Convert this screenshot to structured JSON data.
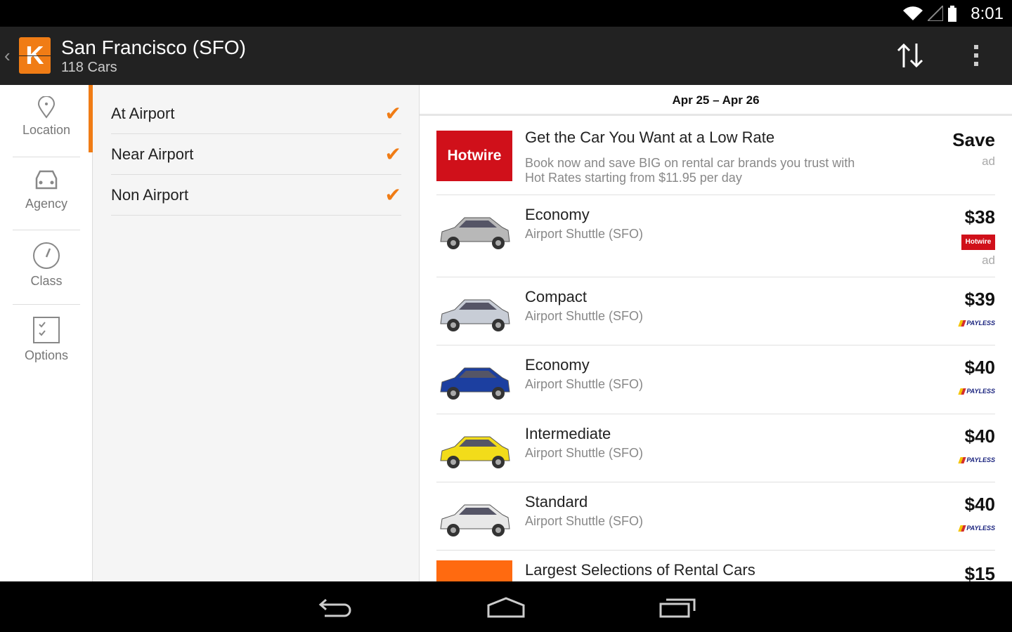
{
  "status": {
    "time": "8:01"
  },
  "header": {
    "title": "San Francisco (SFO)",
    "subtitle": "118 Cars",
    "logo": "K"
  },
  "rail": [
    {
      "label": "Location",
      "icon": "map-pin-icon"
    },
    {
      "label": "Agency",
      "icon": "car-icon"
    },
    {
      "label": "Class",
      "icon": "gauge-icon"
    },
    {
      "label": "Options",
      "icon": "checklist-icon"
    }
  ],
  "filters": [
    {
      "label": "At Airport",
      "checked": true
    },
    {
      "label": "Near Airport",
      "checked": true
    },
    {
      "label": "Non Airport",
      "checked": true
    }
  ],
  "dates": "Apr 25 – Apr 26",
  "ad_row": {
    "brand": "Hotwire",
    "title": "Get the Car You Want at a Low Rate",
    "body": "Book now and save BIG on rental car brands you trust with Hot Rates starting from $11.95 per day",
    "price": "Save",
    "ad": "ad"
  },
  "results": [
    {
      "name": "Economy",
      "location": "Airport Shuttle (SFO)",
      "price": "$38",
      "agency": "Hotwire",
      "ad": "ad",
      "color": "#b8b8b8"
    },
    {
      "name": "Compact",
      "location": "Airport Shuttle (SFO)",
      "price": "$39",
      "agency": "PAYLESS",
      "color": "#c8cdd6"
    },
    {
      "name": "Economy",
      "location": "Airport Shuttle (SFO)",
      "price": "$40",
      "agency": "PAYLESS",
      "color": "#1c3fa0"
    },
    {
      "name": "Intermediate",
      "location": "Airport Shuttle (SFO)",
      "price": "$40",
      "agency": "PAYLESS",
      "color": "#f2dc1a"
    },
    {
      "name": "Standard",
      "location": "Airport Shuttle (SFO)",
      "price": "$40",
      "agency": "PAYLESS",
      "color": "#e8e8e8"
    }
  ],
  "last_row": {
    "title": "Largest Selections of Rental Cars",
    "price": "$15"
  },
  "colors": {
    "accent": "#f07c15",
    "hotwire": "#d0101a"
  }
}
